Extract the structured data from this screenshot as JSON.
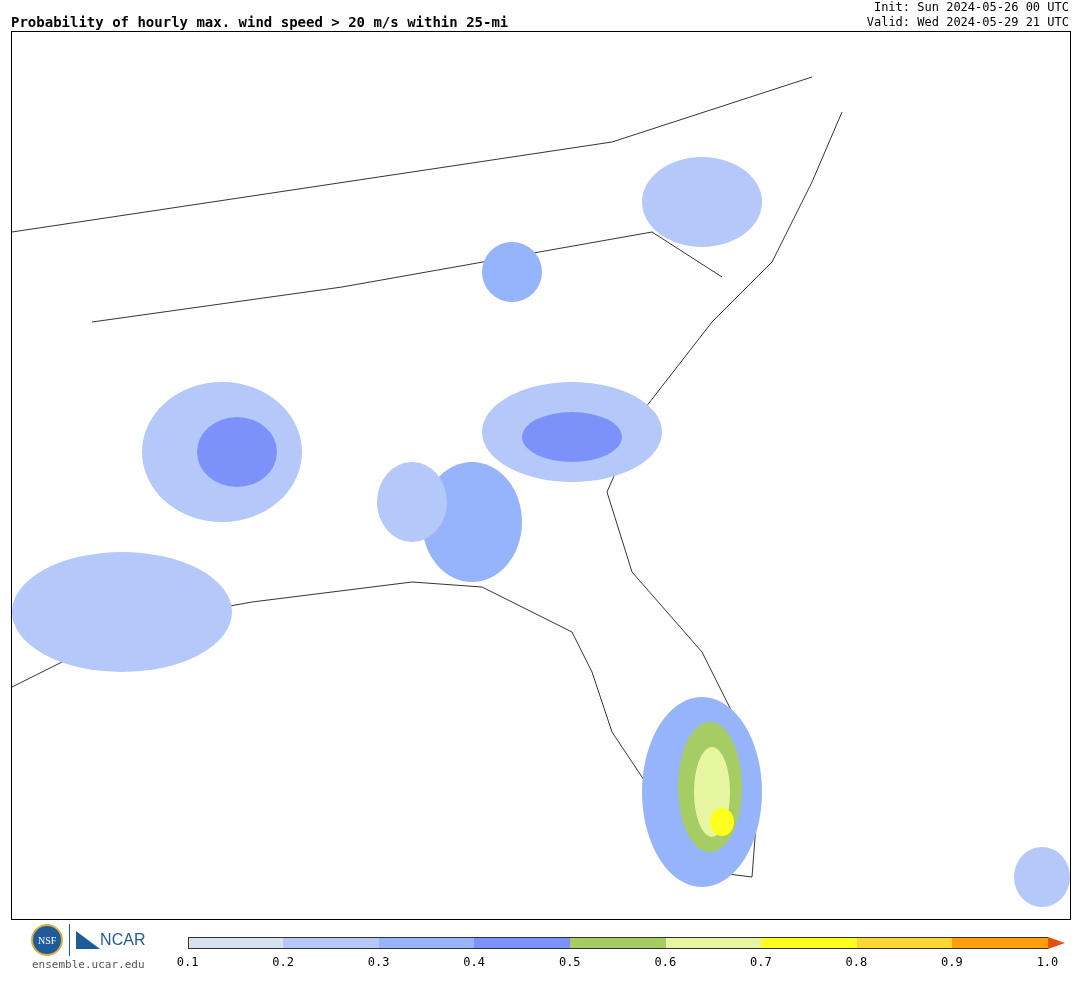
{
  "title": "Probability of hourly max. wind speed > 20 m/s within 25-mi",
  "init": "Init: Sun 2024-05-26 00 UTC",
  "valid": "Valid: Wed 2024-05-29 21 UTC",
  "logos": {
    "nsf": "NSF",
    "ncar": "NCAR",
    "site": "ensemble.ucar.edu"
  },
  "colorbar": {
    "segments": [
      {
        "color": "#d6e2ee"
      },
      {
        "color": "#b4c8fa"
      },
      {
        "color": "#96b4fa"
      },
      {
        "color": "#7d91fa"
      },
      {
        "color": "#a5cd64"
      },
      {
        "color": "#e6f5a0"
      },
      {
        "color": "#ffff1e"
      },
      {
        "color": "#ffd732"
      },
      {
        "color": "#ffa00a"
      }
    ],
    "extension": {
      "color": "#e6500a"
    },
    "ticks": [
      "0.1",
      "0.2",
      "0.3",
      "0.4",
      "0.5",
      "0.6",
      "0.7",
      "0.8",
      "0.9",
      "1.0"
    ]
  }
}
